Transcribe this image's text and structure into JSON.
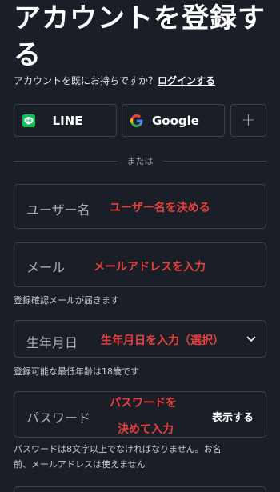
{
  "header": {
    "title": "アカウントを登録する",
    "login_prompt": "アカウントを既にお持ちですか？",
    "login_link": "ログインする"
  },
  "social": {
    "line_label": "LINE",
    "google_label": "Google",
    "more_label": "+"
  },
  "divider": {
    "text": "または"
  },
  "form": {
    "username": {
      "placeholder": "ユーザー名",
      "annotation": "ユーザー名を決める"
    },
    "email": {
      "placeholder": "メール",
      "annotation": "メールアドレスを入力",
      "help": "登録確認メールが届きます"
    },
    "birthdate": {
      "placeholder": "生年月日",
      "annotation": "生年月日を入力（選択）",
      "help": "登録可能な最低年齢は18歳です"
    },
    "password": {
      "placeholder": "パスワード",
      "annotation_line1": "パスワードを",
      "annotation_line2": "決めて入力",
      "show_label": "表示する",
      "help_line1": "パスワードは8文字以上でなければなりません。お名",
      "help_line2": "前、メールアドレスは使えません"
    }
  },
  "colors": {
    "background": "#1a1f27",
    "border": "#3a414c",
    "annotation": "#e83f3f",
    "line_green": "#06c755"
  }
}
